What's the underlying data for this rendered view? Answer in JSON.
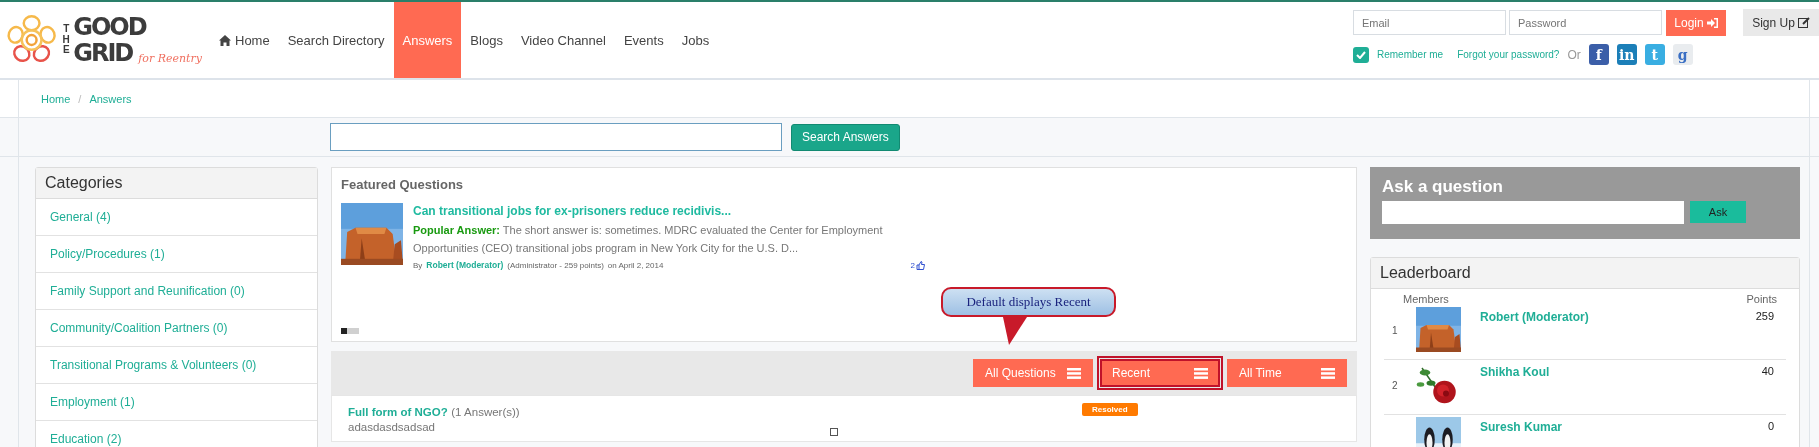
{
  "logo": {
    "the": "THE",
    "good": "GOOD",
    "grid": "GRID",
    "tagline": "for Reentry"
  },
  "nav": [
    {
      "label": "Home",
      "kind": "home",
      "selected": false
    },
    {
      "label": "Search Directory",
      "kind": "plain",
      "selected": false
    },
    {
      "label": "Answers",
      "kind": "plain",
      "selected": true
    },
    {
      "label": "Blogs",
      "kind": "plain",
      "selected": false
    },
    {
      "label": "Video Channel",
      "kind": "plain",
      "selected": false
    },
    {
      "label": "Events",
      "kind": "plain",
      "selected": false
    },
    {
      "label": "Jobs",
      "kind": "plain",
      "selected": false
    }
  ],
  "login": {
    "email_placeholder": "Email",
    "password_placeholder": "Password",
    "login_button": "Login",
    "signup_button": "Sign Up",
    "remember_me": {
      "label": "Remember me",
      "checked": true
    },
    "forgot_link": "Forgot your password?",
    "or_label": "Or",
    "social": [
      {
        "kind": "facebook",
        "glyph": "f"
      },
      {
        "kind": "linkedin",
        "glyph": "in"
      },
      {
        "kind": "twitter",
        "glyph": "t"
      },
      {
        "kind": "google",
        "glyph": "g"
      }
    ]
  },
  "breadcrumb": {
    "separator": "/",
    "items": [
      {
        "label": "Home"
      },
      {
        "label": "Answers"
      }
    ]
  },
  "search": {
    "button": "Search Answers"
  },
  "categories": {
    "title": "Categories",
    "items": [
      {
        "label": "General (4)"
      },
      {
        "label": "Policy/Procedures (1)"
      },
      {
        "label": "Family Support and Reunification (0)"
      },
      {
        "label": "Community/Coalition Partners (0)"
      },
      {
        "label": "Transitional Programs & Volunteers (0)"
      },
      {
        "label": "Employment (1)"
      },
      {
        "label": "Education (2)"
      }
    ]
  },
  "featured": {
    "title": "Featured Questions",
    "item": {
      "question": "Can transitional jobs for ex-prisoners reduce recidivis...",
      "answer": "**Popular Answer:** The short answer is: sometimes. MDRC evaluated the Center for Employment Opportunities (CEO) transitional jobs program in New York City for the U.S. D...",
      "by_label": "By",
      "author": "Robert (Moderator)",
      "role": "(Administrator - 259 points)",
      "date": "on April 2, 2014",
      "likes": "2"
    },
    "indicators": [
      {
        "selected": true
      },
      {
        "selected": false
      },
      {
        "selected": false
      }
    ]
  },
  "callout": "Default displays Recent",
  "filters": [
    {
      "label": "All Questions",
      "highlighted": false
    },
    {
      "label": "Recent",
      "highlighted": true
    },
    {
      "label": "All Time",
      "highlighted": false
    }
  ],
  "questions": [
    {
      "title": "Full form of NGO?",
      "answers": "(1 Answer(s))",
      "body": "adasdasdsadsad",
      "status": "Resolved"
    }
  ],
  "ask": {
    "title": "Ask a question",
    "button": "Ask"
  },
  "leaderboard": {
    "title": "Leaderboard",
    "members_header": "Members",
    "points_header": "Points",
    "rows": [
      {
        "rank": "1",
        "name": "Robert (Moderator)",
        "points": "259"
      },
      {
        "rank": "2",
        "name": "Shikha Koul",
        "points": "40"
      },
      {
        "name": "Suresh Kumar",
        "points": "0"
      }
    ]
  }
}
